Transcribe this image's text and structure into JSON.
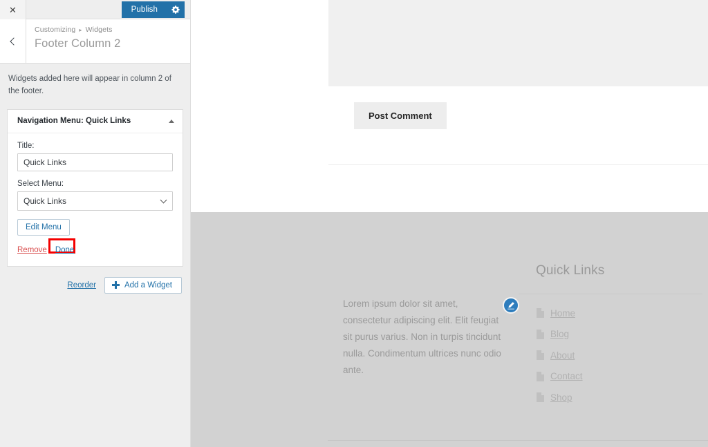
{
  "customizer": {
    "header": {
      "close_label": "Close",
      "close_icon": "close-icon",
      "publish_label": "Publish",
      "publish_settings_icon": "gear-icon",
      "publish_color": "#2271a8"
    },
    "panel": {
      "back_icon": "chevron-left-icon",
      "breadcrumb_root": "Customizing",
      "breadcrumb_separator": "▸",
      "breadcrumb_parent": "Widgets",
      "title": "Footer Column 2"
    },
    "section_description": "Widgets added here will appear in column 2 of the footer.",
    "widget": {
      "header_title": "Navigation Menu: Quick Links",
      "collapse_icon": "caret-up-icon",
      "title_field_label": "Title:",
      "title_field_value": "Quick Links",
      "title_field_placeholder": "",
      "select_menu_label": "Select Menu:",
      "select_menu_value": "Quick Links",
      "select_menu_options": [
        "Quick Links"
      ],
      "edit_menu_label": "Edit Menu",
      "remove_label": "Remove",
      "done_label": "Done",
      "remove_color": "#d94f4f",
      "done_color": "#2271a8"
    },
    "controls": {
      "reorder_label": "Reorder",
      "add_widget_label": "Add a Widget",
      "add_widget_icon": "plus-icon"
    },
    "annotation": {
      "highlight_target": "Done",
      "highlight_color": "#f40000"
    }
  },
  "preview": {
    "comment_form": {
      "textarea_value": "",
      "submit_label": "Post Comment"
    },
    "footer": {
      "background_color": "#d2d2d2",
      "column_1": {
        "text": "Lorem ipsum dolor sit amet, consectetur adipiscing elit. Elit feugiat sit purus varius. Non in turpis tincidunt nulla. Condimentum ultrices nunc odio ante."
      },
      "column_2": {
        "heading": "Quick Links",
        "menu_items": [
          {
            "label": "Home",
            "icon": "page-icon"
          },
          {
            "label": "Blog",
            "icon": "page-icon"
          },
          {
            "label": "About",
            "icon": "page-icon"
          },
          {
            "label": "Contact",
            "icon": "page-icon"
          },
          {
            "label": "Shop",
            "icon": "page-icon"
          }
        ]
      }
    },
    "edit_shortcuts": [
      {
        "name": "edit-shortcut-text-widget",
        "icon": "pencil-icon"
      },
      {
        "name": "edit-shortcut-nav-heading",
        "icon": "pencil-icon"
      },
      {
        "name": "edit-shortcut-nav-menu",
        "icon": "pencil-icon"
      }
    ]
  }
}
